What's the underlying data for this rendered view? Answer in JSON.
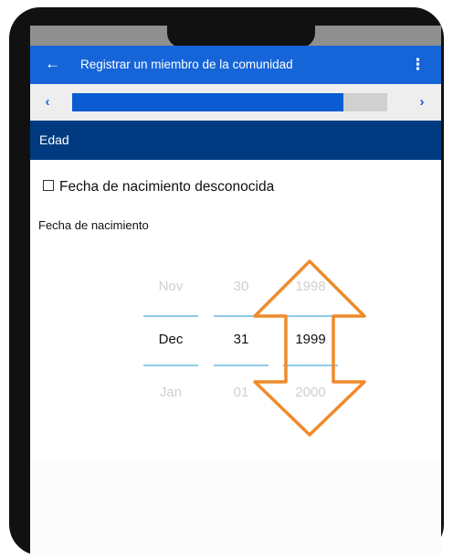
{
  "app_bar": {
    "back_icon": "arrow-left-icon",
    "title": "Registrar un miembro de la comunidad",
    "menu_icon": "more-vert-icon"
  },
  "progress": {
    "prev_icon": "chevron-left-icon",
    "next_icon": "chevron-right-icon",
    "fraction": 0.86
  },
  "section": {
    "title": "Edad"
  },
  "form": {
    "unknown_dob_label": "Fecha de nacimiento desconocida",
    "unknown_dob_checked": false,
    "dob_label": "Fecha de nacimiento"
  },
  "date_picker": {
    "month": {
      "prev": "Nov",
      "selected": "Dec",
      "next": "Jan"
    },
    "day": {
      "prev": "30",
      "selected": "31",
      "next": "01"
    },
    "year": {
      "prev": "1998",
      "selected": "1999",
      "next": "2000"
    }
  },
  "colors": {
    "app_bar": "#1565d8",
    "section_bar": "#003a80",
    "progress_fill": "#0b5bd3",
    "highlight_arrow": "#f08a2a"
  }
}
